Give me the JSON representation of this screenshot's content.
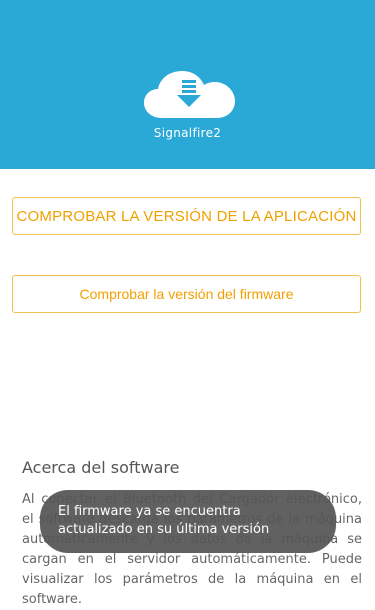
{
  "header": {
    "app_name": "Signalfire2",
    "icon": "cloud-download-icon",
    "background_color": "#2aa9d6"
  },
  "buttons": {
    "check_app_version": "COMPROBAR LA VERSIÓN DE LA APLICACIÓN",
    "check_firmware_version": "Comprobar la versión del firmware",
    "accent_color": "#f0a000"
  },
  "about": {
    "title": "Acerca del software",
    "text": "Al conectar el Bluetooth del Cargador electrónico, el software descarga los parámetros de la máquina automáticamente y los datos de la máquina se cargan en el servidor automáticamente. Puede visualizar los parámetros de la máquina en el software."
  },
  "toast": {
    "line1": "El firmware ya se encuentra",
    "line2": "actualizado en su última versión"
  }
}
